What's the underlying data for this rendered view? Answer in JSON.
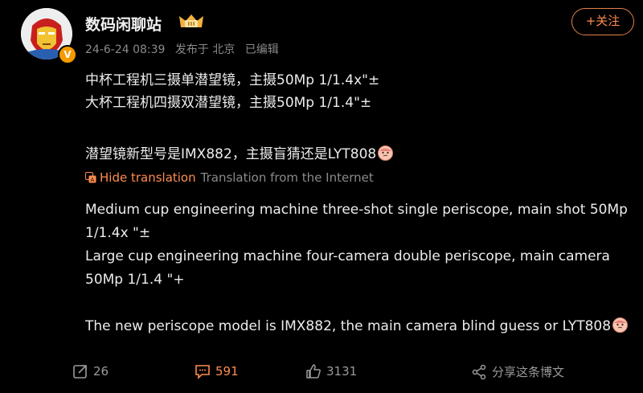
{
  "post": {
    "author": {
      "name": "数码闲聊站",
      "avatar_icon": "ironman-avatar-icon",
      "badge_icon": "crown-level-icon",
      "verified_icon": "verified-v-icon",
      "verified_mark": "V"
    },
    "meta": {
      "date": "24-6-24 08:39",
      "location": "发布于 北京",
      "edited": "已编辑"
    },
    "follow_label": "+关注",
    "content": {
      "line1": "中杯工程机三摄单潜望镜，主摄50Mp 1/1.4x\"±",
      "line2": "大杯工程机四摄双潜望镜，主摄50Mp 1/1.4\"±",
      "line3": "潜望镜新型号是IMX882，主摄盲猜还是LYT808"
    },
    "translation": {
      "hide_label": "Hide translation",
      "source_label": "Translation from the Internet",
      "line1a": "Medium cup engineering machine three-shot single periscope, main shot 50Mp",
      "line1b": "1/1.4x \"±",
      "line2a": "Large cup engineering machine four-camera double periscope, main camera",
      "line2b": "50Mp 1/1.4 \"+",
      "line3": "The new periscope model is IMX882, the main camera blind guess or LYT808"
    },
    "actions": {
      "repost_count": "26",
      "comment_count": "591",
      "like_count": "3131",
      "share_label": "分享这条博文"
    },
    "colors": {
      "accent": "#ff8d4f",
      "background": "#000000",
      "text": "#ececec",
      "muted": "#8a8a8a"
    }
  }
}
